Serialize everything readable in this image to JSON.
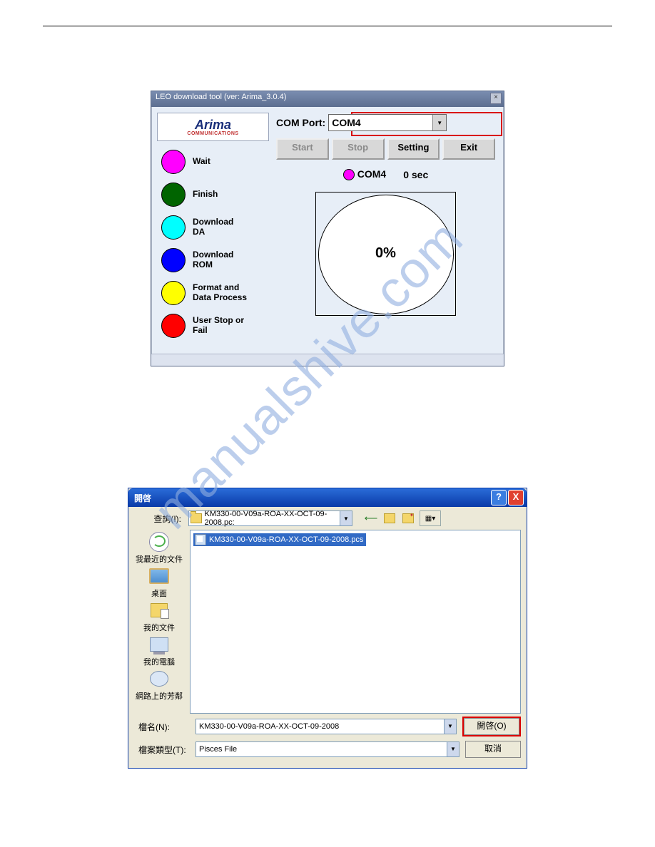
{
  "watermark": "manualshive.com",
  "win1": {
    "title": "LEO download tool  (ver: Arima_3.0.4)",
    "logo_main": "Arima",
    "logo_sub": "COMMUNICATIONS",
    "legend": [
      {
        "color": "#ff00ff",
        "label": "Wait"
      },
      {
        "color": "#006400",
        "label": "Finish"
      },
      {
        "color": "#00ffff",
        "label": "Download\nDA"
      },
      {
        "color": "#0000ff",
        "label": "Download\nROM"
      },
      {
        "color": "#ffff00",
        "label": "Format and\nData Process"
      },
      {
        "color": "#ff0000",
        "label": "User Stop or\nFail"
      }
    ],
    "com_label": "COM Port:",
    "com_value": "COM4",
    "buttons": {
      "start": "Start",
      "stop": "Stop",
      "setting": "Setting",
      "exit": "Exit"
    },
    "status_port": "COM4",
    "status_time": "0 sec",
    "progress": "0%"
  },
  "win2": {
    "title": "開啓",
    "lookin_label": "查詢(I):",
    "lookin_value": "KM330-00-V09a-ROA-XX-OCT-09-2008.pc:",
    "places": {
      "recent": "我最近的文件",
      "desktop": "桌面",
      "mydocs": "我的文件",
      "mycomputer": "我的電腦",
      "network": "網路上的芳鄰"
    },
    "file_selected": "KM330-00-V09a-ROA-XX-OCT-09-2008.pcs",
    "filename_label": "檔名(N):",
    "filename_value": "KM330-00-V09a-ROA-XX-OCT-09-2008",
    "filetype_label": "檔案類型(T):",
    "filetype_value": "Pisces File",
    "open": "開啓(O)",
    "cancel": "取消"
  }
}
